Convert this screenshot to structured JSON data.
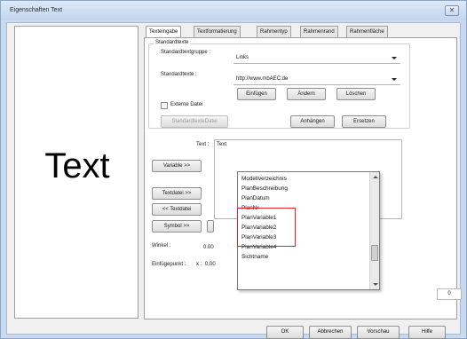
{
  "window": {
    "title": "Eigenschaften Text",
    "close_glyph": "✕"
  },
  "preview": {
    "text": "Text"
  },
  "tabs": [
    {
      "label": "Texteingabe"
    },
    {
      "label": "Textformatierung"
    },
    {
      "label": "Rahmentyp"
    },
    {
      "label": "Rahmenrand"
    },
    {
      "label": "Rahmenfläche"
    }
  ],
  "standardtexte": {
    "group_label": "Standardtexte",
    "gruppe_label": "Standardtextgruppe :",
    "gruppe_value": "Links",
    "texte_label": "Standardtexte :",
    "texte_value": "http://www.mbAEC.de",
    "einfuegen": "Einfügen",
    "aendern": "Ändern",
    "loeschen": "Löschen",
    "externe_datei": "Externe Datei",
    "standardtextedatei": "StandardtexteDatei",
    "anhaengen": "Anhängen",
    "ersetzen": "Ersetzen"
  },
  "text_section": {
    "text_label": "Text :",
    "text_value": "Text",
    "variable_btn": "Variable >>",
    "textdatei_btn": "Textdatei >>",
    "back_textdatei_btn": "<< Textdatei",
    "symbol_btn": "Symbol >>",
    "winkel_label": "Winkel :",
    "winkel_value": "0.00",
    "einfuegepunkt_label": "Einfügepunkt :",
    "x_label": "x :",
    "x_value": "0.00",
    "spin_value": "0"
  },
  "variable_list": [
    "Modellverzeichnis",
    "PlanBeschreibung",
    "PlanDatum",
    "PlanNr",
    "PlanVariable1",
    "PlanVariable2",
    "PlanVariable3",
    "PlanVariable4",
    "Sichtname"
  ],
  "footer": {
    "ok": "OK",
    "abbrechen": "Abbrechen",
    "vorschau": "Vorschau",
    "hilfe": "Hilfe"
  },
  "colors": {
    "highlight": "#e0242a",
    "titlebar": "#c9daf0"
  }
}
